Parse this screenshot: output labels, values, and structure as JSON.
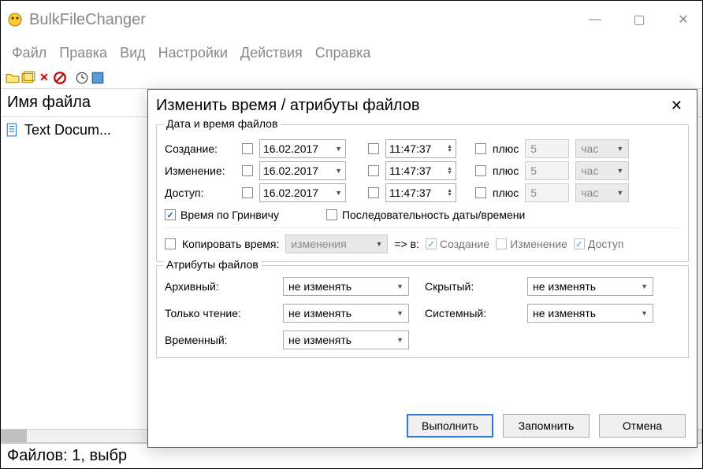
{
  "app": {
    "title": "BulkFileChanger"
  },
  "win_controls": {
    "min": "—",
    "max": "▢",
    "close": "✕"
  },
  "menus": [
    "Файл",
    "Правка",
    "Вид",
    "Настройки",
    "Действия",
    "Справка"
  ],
  "list": {
    "header": "Имя файла",
    "files": [
      {
        "name": "Text Docum..."
      }
    ]
  },
  "statusbar": "Файлов: 1, выбр",
  "dialog": {
    "title": "Изменить время / атрибуты файлов",
    "close": "✕",
    "group_datetime": {
      "title": "Дата и время файлов",
      "rows": [
        {
          "label": "Создание:",
          "date": "16.02.2017",
          "time": "11:47:37",
          "plus": "плюс",
          "num": "5",
          "unit": "час"
        },
        {
          "label": "Изменение:",
          "date": "16.02.2017",
          "time": "11:47:37",
          "plus": "плюс",
          "num": "5",
          "unit": "час"
        },
        {
          "label": "Доступ:",
          "date": "16.02.2017",
          "time": "11:47:37",
          "plus": "плюс",
          "num": "5",
          "unit": "час"
        }
      ],
      "gmt": "Время по Гринвичу",
      "sequence": "Последовательность даты/времени",
      "copy": {
        "label": "Копировать время:",
        "from": "изменения",
        "arrow": "=> в:",
        "targets": {
          "c": "Создание",
          "m": "Изменение",
          "a": "Доступ"
        }
      }
    },
    "group_attrs": {
      "title": "Атрибуты файлов",
      "nochange": "не изменять",
      "labels": {
        "archive": "Архивный:",
        "hidden": "Скрытый:",
        "readonly": "Только чтение:",
        "system": "Системный:",
        "temp": "Временный:"
      }
    },
    "buttons": {
      "run": "Выполнить",
      "save": "Запомнить",
      "cancel": "Отмена"
    }
  }
}
